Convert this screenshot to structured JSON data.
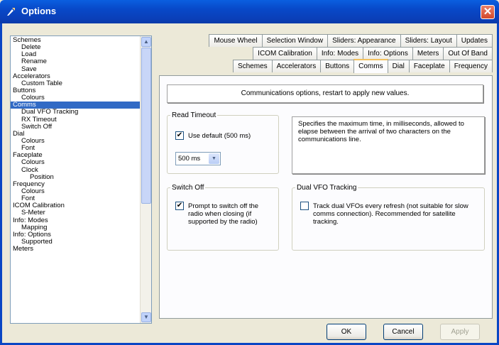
{
  "window": {
    "title": "Options",
    "close": "✕"
  },
  "tree": {
    "items": [
      {
        "label": "Schemes",
        "level": 0
      },
      {
        "label": "Delete",
        "level": 1
      },
      {
        "label": "Load",
        "level": 1
      },
      {
        "label": "Rename",
        "level": 1
      },
      {
        "label": "Save",
        "level": 1
      },
      {
        "label": "Accelerators",
        "level": 0
      },
      {
        "label": "Custom Table",
        "level": 1
      },
      {
        "label": "Buttons",
        "level": 0
      },
      {
        "label": "Colours",
        "level": 1
      },
      {
        "label": "Comms",
        "level": 0,
        "selected": true
      },
      {
        "label": "Dual VFO Tracking",
        "level": 1
      },
      {
        "label": "RX Timeout",
        "level": 1
      },
      {
        "label": "Switch Off",
        "level": 1
      },
      {
        "label": "Dial",
        "level": 0
      },
      {
        "label": "Colours",
        "level": 1
      },
      {
        "label": "Font",
        "level": 1
      },
      {
        "label": "Faceplate",
        "level": 0
      },
      {
        "label": "Colours",
        "level": 1
      },
      {
        "label": "Clock",
        "level": 1
      },
      {
        "label": "Position",
        "level": 2
      },
      {
        "label": "Frequency",
        "level": 0
      },
      {
        "label": "Colours",
        "level": 1
      },
      {
        "label": "Font",
        "level": 1
      },
      {
        "label": "ICOM Calibration",
        "level": 0
      },
      {
        "label": "S-Meter",
        "level": 1
      },
      {
        "label": "Info: Modes",
        "level": 0
      },
      {
        "label": "Mapping",
        "level": 1
      },
      {
        "label": "Info: Options",
        "level": 0
      },
      {
        "label": "Supported",
        "level": 1
      },
      {
        "label": "Meters",
        "level": 0
      }
    ]
  },
  "tabs": {
    "row1": [
      "Mouse Wheel",
      "Selection Window",
      "Sliders: Appearance",
      "Sliders: Layout",
      "Updates"
    ],
    "row2": [
      "ICOM Calibration",
      "Info: Modes",
      "Info: Options",
      "Meters",
      "Out Of Band"
    ],
    "row3": [
      "Schemes",
      "Accelerators",
      "Buttons",
      "Comms",
      "Dial",
      "Faceplate",
      "Frequency"
    ],
    "active": "Comms"
  },
  "panel": {
    "banner": "Communications options, restart to apply new values.",
    "read_timeout": {
      "legend": "Read Timeout",
      "checkbox_label": "Use default (500 ms)",
      "checked": true,
      "select_value": "500 ms"
    },
    "description": "Specifies the maximum time, in milliseconds, allowed to elapse between the arrival of two characters on the communications line.",
    "switch_off": {
      "legend": "Switch Off",
      "checkbox_label": "Prompt to switch off the radio when closing (if supported by the radio)",
      "checked": true
    },
    "dual_vfo": {
      "legend": "Dual VFO Tracking",
      "checkbox_label": "Track dual VFOs every refresh (not suitable for slow comms connection). Recommended for satellite tracking.",
      "checked": false
    }
  },
  "buttons": {
    "ok": "OK",
    "cancel": "Cancel",
    "apply": "Apply"
  },
  "colors": {
    "titlebar": "#0a4fd8",
    "selection": "#316ac5",
    "tab_highlight": "#f3c25f"
  }
}
